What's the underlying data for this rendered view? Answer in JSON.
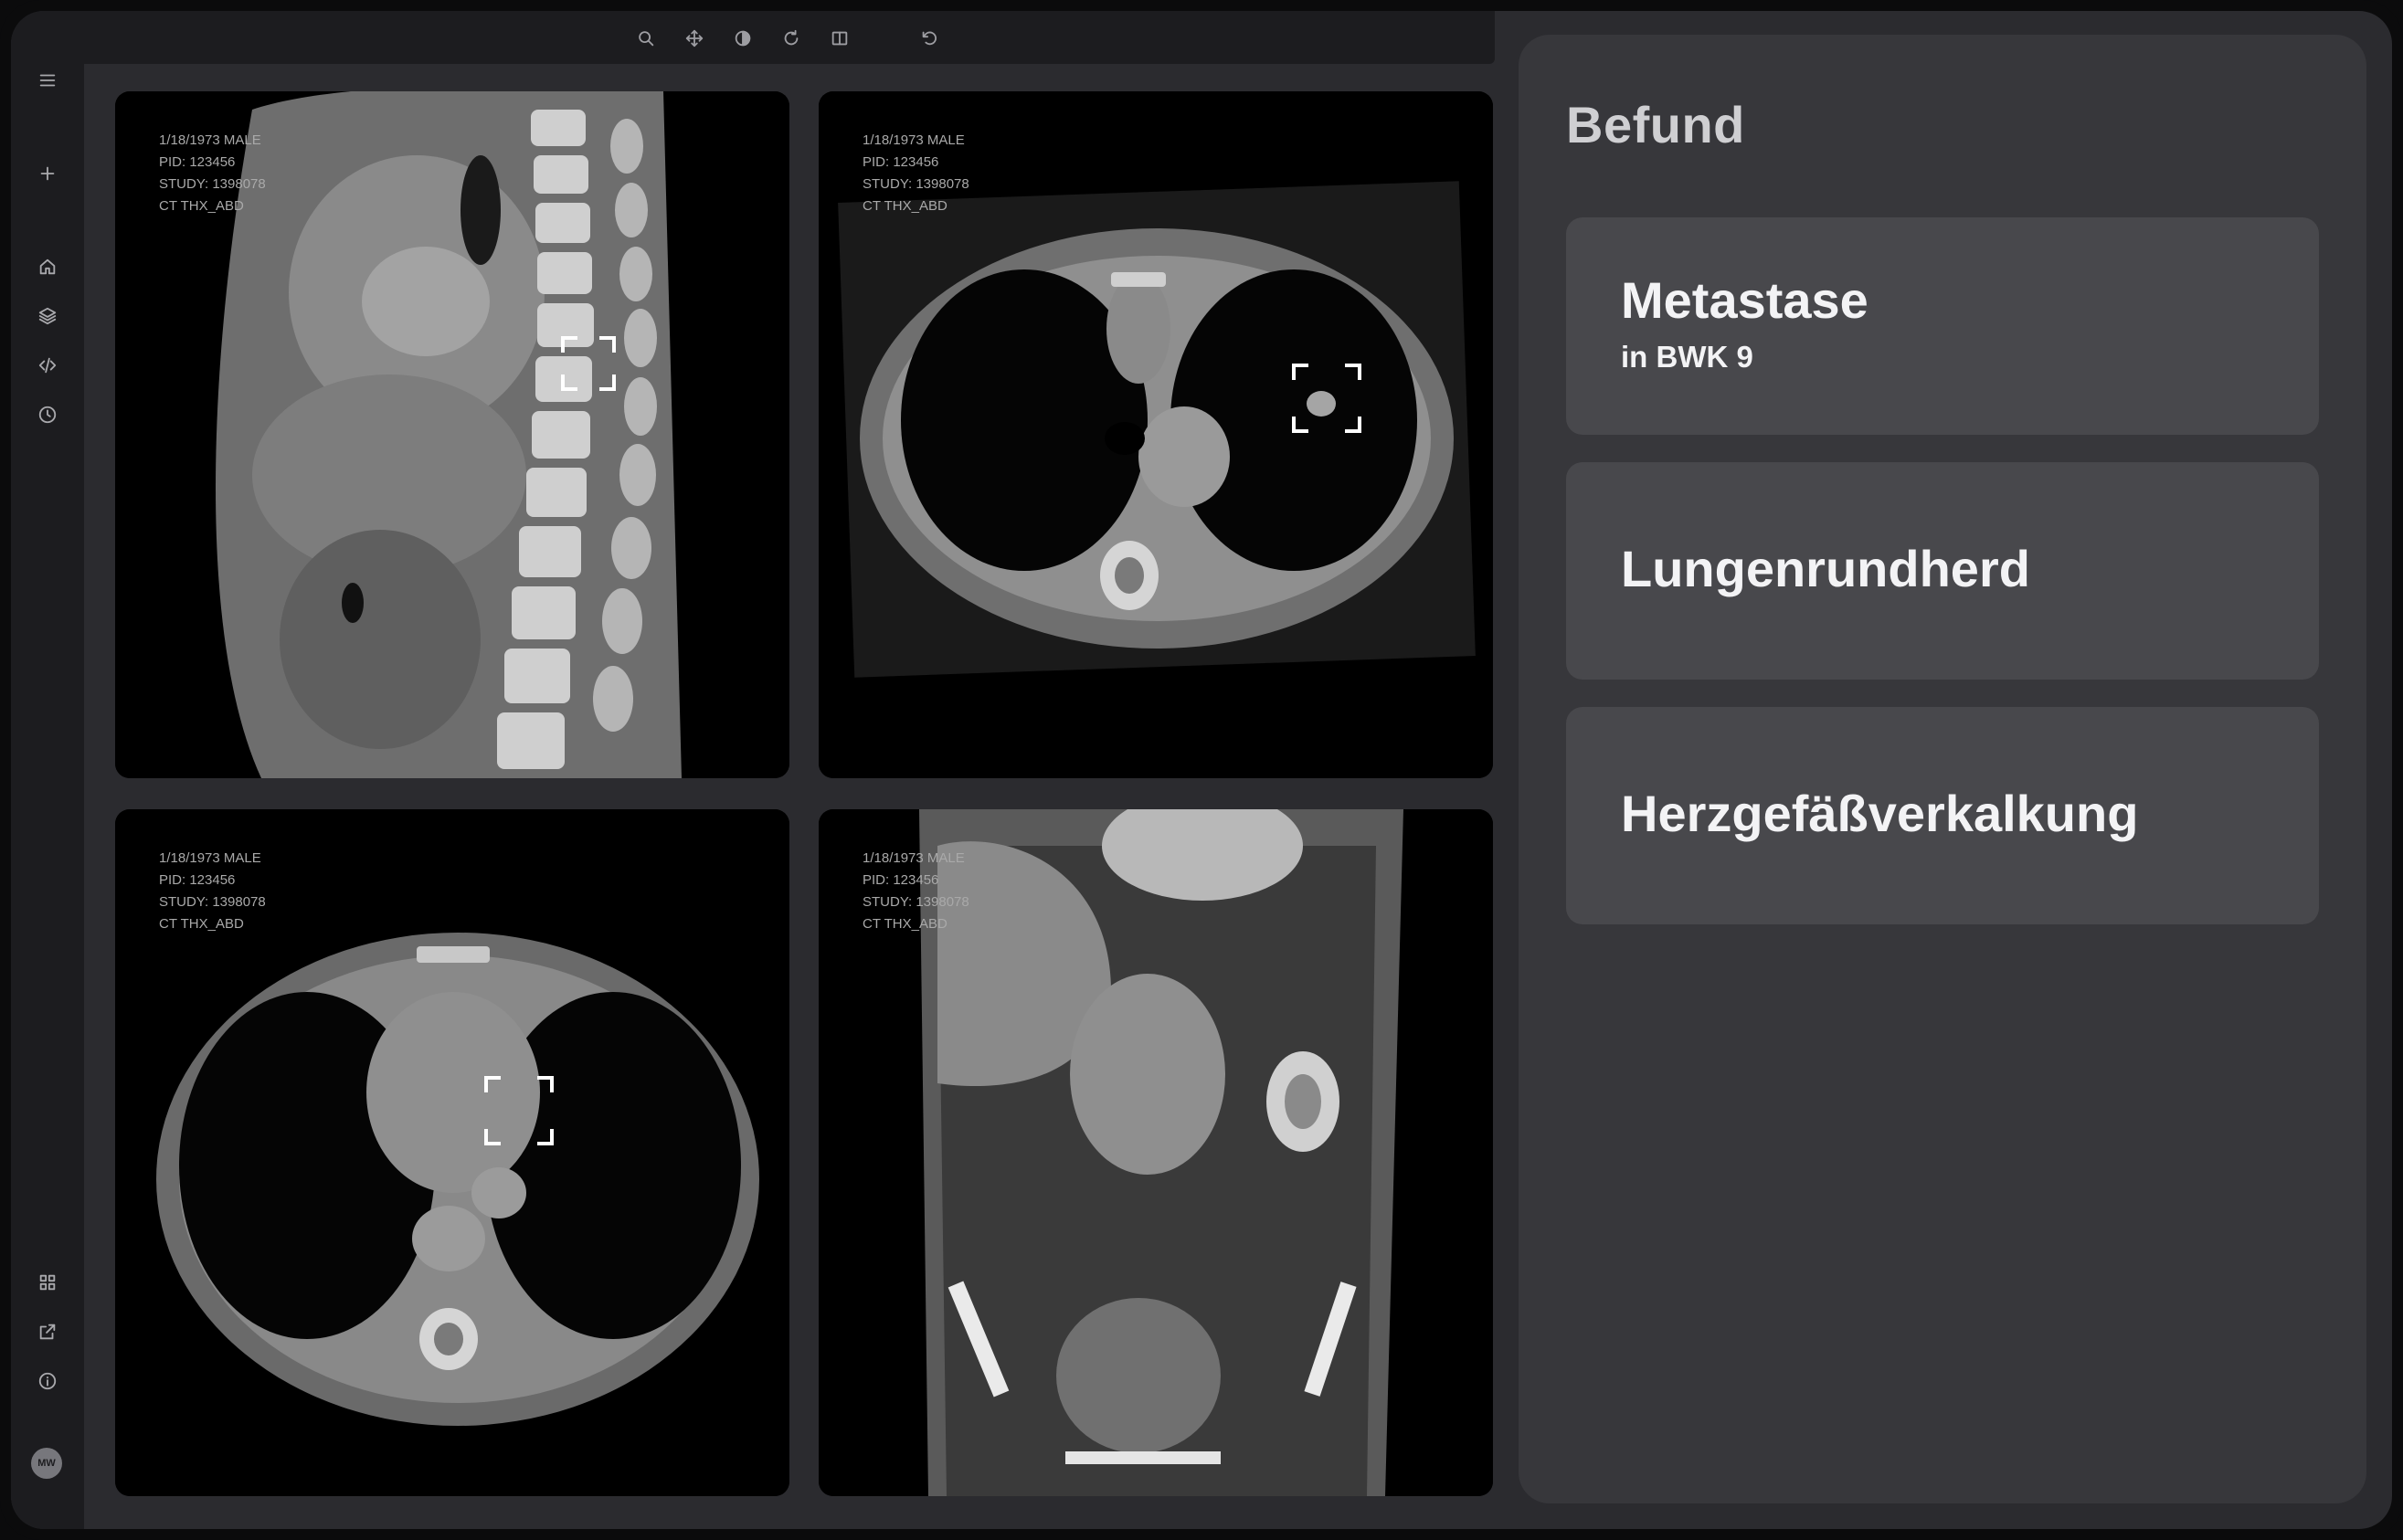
{
  "toolbar": {
    "tools": [
      "zoom-icon",
      "pan-icon",
      "contrast-icon",
      "rotate-icon",
      "compare-icon",
      "undo-icon"
    ]
  },
  "sidebar": {
    "top_items": [
      "menu-icon",
      "add-icon",
      "home-icon",
      "layers-icon",
      "code-icon",
      "history-icon"
    ],
    "bottom_items": [
      "grid-icon",
      "external-link-icon",
      "info-icon"
    ],
    "avatar_initials": "MW"
  },
  "viewports": [
    {
      "view": "sagittal",
      "dob_sex": "1/18/1973 MALE",
      "pid": "PID: 123456",
      "study": "STUDY: 1398078",
      "series": "CT THX_ABD",
      "has_marker": true
    },
    {
      "view": "axial-lung",
      "dob_sex": "1/18/1973 MALE",
      "pid": "PID: 123456",
      "study": "STUDY: 1398078",
      "series": "CT THX_ABD",
      "has_marker": true
    },
    {
      "view": "axial-lung",
      "dob_sex": "1/18/1973 MALE",
      "pid": "PID: 123456",
      "study": "STUDY: 1398078",
      "series": "CT THX_ABD",
      "has_marker": true
    },
    {
      "view": "coronal",
      "dob_sex": "1/18/1973 MALE",
      "pid": "PID: 123456",
      "study": "STUDY: 1398078",
      "series": "CT THX_ABD",
      "has_marker": false
    }
  ],
  "findings": {
    "title": "Befund",
    "cards": [
      {
        "title": "Metastase",
        "subtitle": "in BWK 9"
      },
      {
        "title": "Lungenrundherd",
        "subtitle": ""
      },
      {
        "title": "Herzgefäßverkalkung",
        "subtitle": ""
      }
    ]
  }
}
